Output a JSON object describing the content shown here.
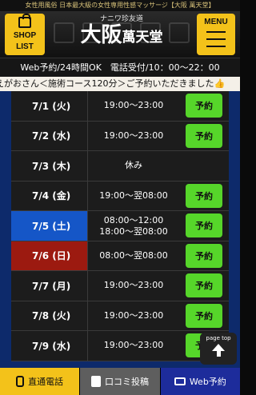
{
  "topline": "女性用風俗 日本最大級の女性専用性感マッサージ【大阪 萬天堂】",
  "header": {
    "shoplist_line1": "SHOP",
    "shoplist_line2": "LIST",
    "logo_small": "ナニワ珍友道",
    "logo_big": "大阪",
    "logo_sub": "萬天堂",
    "menu_label": "MENU"
  },
  "infobar": "Web予約/24時間OK　電話受付/10：00〜22：00",
  "marquee": "えがおさん＜施術コース120分＞ご予約いただきました👍",
  "schedule": [
    {
      "date": "7/1 (火)",
      "time": "19:00〜23:00",
      "action": "予約"
    },
    {
      "date": "7/2 (水)",
      "time": "19:00〜23:00",
      "action": "予約"
    },
    {
      "date": "7/3 (木)",
      "time": "休み",
      "action": ""
    },
    {
      "date": "7/4 (金)",
      "time": "19:00〜翌08:00",
      "action": "予約"
    },
    {
      "date": "7/5 (土)",
      "time": "08:00〜12:00",
      "time2": "18:00〜翌08:00",
      "action": "予約"
    },
    {
      "date": "7/6 (日)",
      "time": "08:00〜翌08:00",
      "action": "予約"
    },
    {
      "date": "7/7 (月)",
      "time": "19:00〜23:00",
      "action": "予約"
    },
    {
      "date": "7/8 (火)",
      "time": "19:00〜23:00",
      "action": "予約"
    },
    {
      "date": "7/9 (水)",
      "time": "19:00〜23:00",
      "action": "予約"
    }
  ],
  "pagetop": "page top",
  "footer": {
    "phone": "直通電話",
    "review": "口コミ投稿",
    "web": "Web予約"
  },
  "colors": {
    "accent_yellow": "#f3c21a",
    "reserve_green": "#56d62a",
    "saturday_blue": "#1556c7",
    "sunday_red": "#9c1a10",
    "footer_blue": "#1d2c9b"
  }
}
